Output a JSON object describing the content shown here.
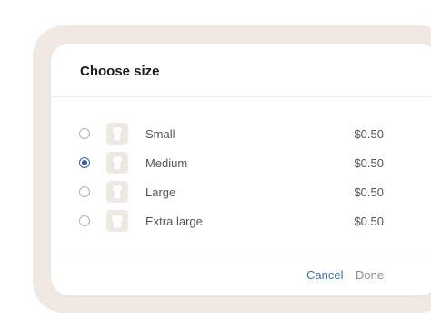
{
  "dialog": {
    "title": "Choose size"
  },
  "options": [
    {
      "label": "Small",
      "price": "$0.50",
      "selected": false,
      "icon": "tshirt-thumbnail"
    },
    {
      "label": "Medium",
      "price": "$0.50",
      "selected": true,
      "icon": "tshirt-thumbnail"
    },
    {
      "label": "Large",
      "price": "$0.50",
      "selected": false,
      "icon": "tshirt-thumbnail"
    },
    {
      "label": "Extra large",
      "price": "$0.50",
      "selected": false,
      "icon": "tshirt-thumbnail"
    }
  ],
  "footer": {
    "cancel_label": "Cancel",
    "done_label": "Done"
  },
  "colors": {
    "accent": "#3a5fb0",
    "link": "#3a76b0",
    "backdrop": "#efe8e3"
  }
}
